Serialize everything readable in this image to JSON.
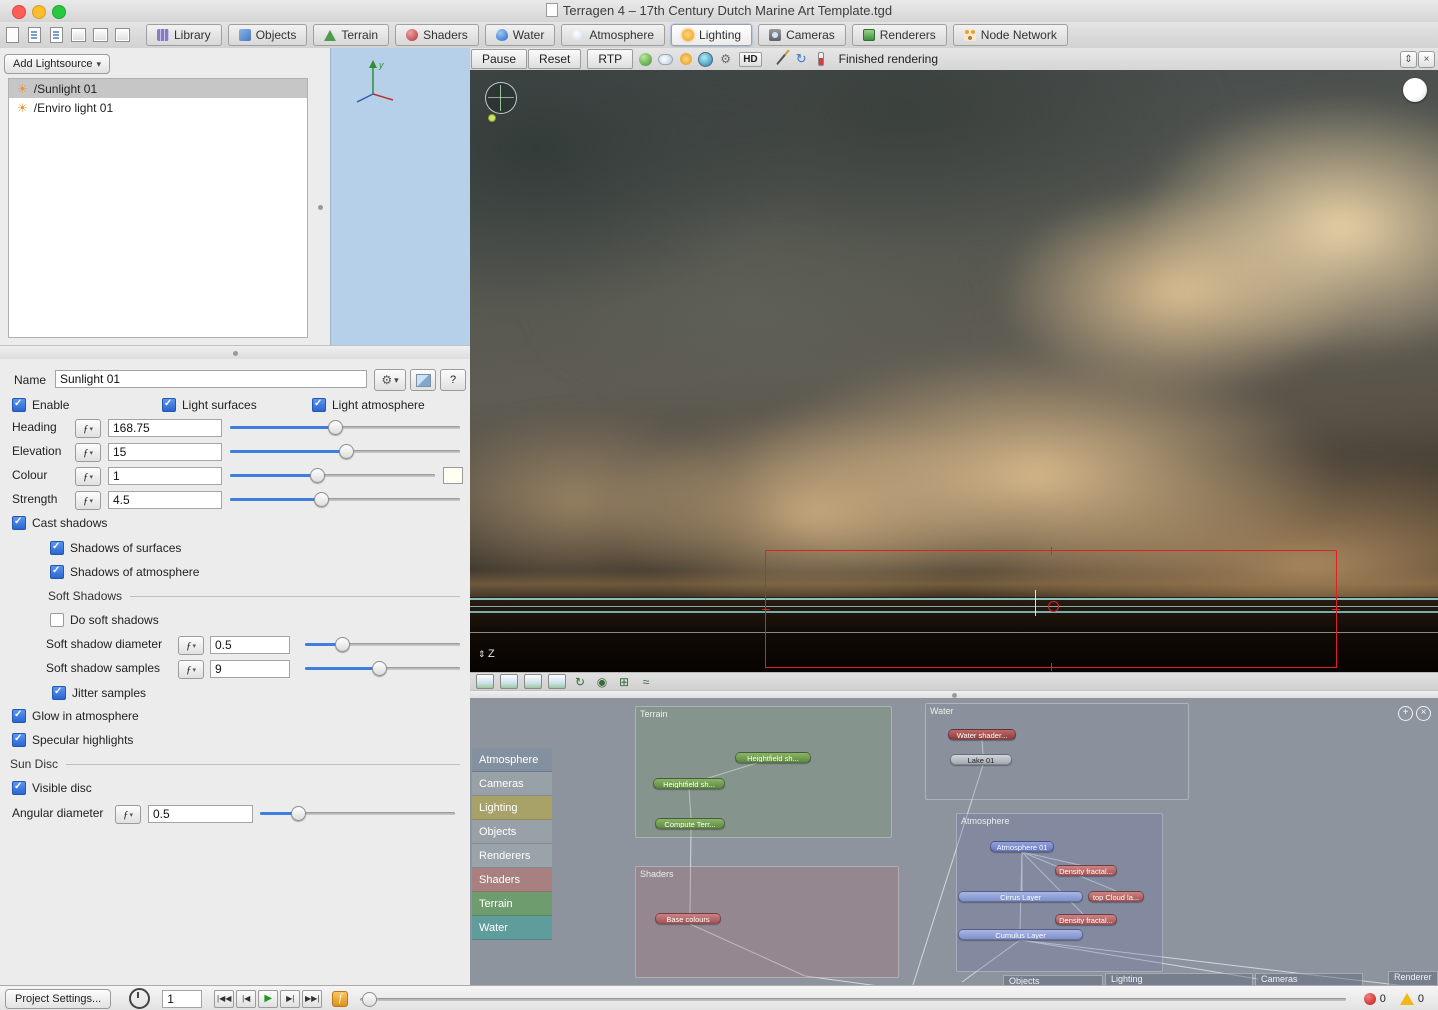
{
  "titlebar": {
    "title": "Terragen 4 – 17th Century Dutch Marine Art Template.tgd"
  },
  "toolbar": {
    "tabs": [
      {
        "label": "Library"
      },
      {
        "label": "Objects"
      },
      {
        "label": "Terrain"
      },
      {
        "label": "Shaders"
      },
      {
        "label": "Water"
      },
      {
        "label": "Atmosphere"
      },
      {
        "label": "Lighting"
      },
      {
        "label": "Cameras"
      },
      {
        "label": "Renderers"
      },
      {
        "label": "Node Network"
      }
    ]
  },
  "lightsources": {
    "add_button": "Add Lightsource",
    "items": [
      {
        "label": "/Sunlight 01"
      },
      {
        "label": "/Enviro light 01"
      }
    ]
  },
  "render_controls": {
    "pause": "Pause",
    "reset": "Reset",
    "rtp": "RTP",
    "hd": "HD",
    "status": "Finished rendering"
  },
  "render_view": {
    "z_label": "Z"
  },
  "settings": {
    "name_label": "Name",
    "name_value": "Sunlight 01",
    "help_label": "?",
    "enable_label": "Enable",
    "light_surfaces_label": "Light surfaces",
    "light_atmosphere_label": "Light atmosphere",
    "heading": {
      "label": "Heading",
      "value": "168.75"
    },
    "elevation": {
      "label": "Elevation",
      "value": "15"
    },
    "colour": {
      "label": "Colour",
      "value": "1"
    },
    "strength": {
      "label": "Strength",
      "value": "4.5"
    },
    "cast_shadows_label": "Cast shadows",
    "shadows_of_surfaces_label": "Shadows of surfaces",
    "shadows_of_atmosphere_label": "Shadows of atmosphere",
    "soft_shadows_header": "Soft Shadows",
    "do_soft_shadows_label": "Do soft shadows",
    "soft_shadow_diameter": {
      "label": "Soft shadow diameter",
      "value": "0.5"
    },
    "soft_shadow_samples": {
      "label": "Soft shadow samples",
      "value": "9"
    },
    "jitter_samples_label": "Jitter samples",
    "glow_in_atmosphere_label": "Glow in atmosphere",
    "specular_highlights_label": "Specular highlights",
    "sun_disc_header": "Sun Disc",
    "visible_disc_label": "Visible disc",
    "angular_diameter": {
      "label": "Angular diameter",
      "value": "0.5"
    }
  },
  "node_network": {
    "categories": [
      {
        "label": "Atmosphere"
      },
      {
        "label": "Cameras"
      },
      {
        "label": "Lighting"
      },
      {
        "label": "Objects"
      },
      {
        "label": "Renderers"
      },
      {
        "label": "Shaders"
      },
      {
        "label": "Terrain"
      },
      {
        "label": "Water"
      }
    ],
    "groups": [
      {
        "label": "Terrain"
      },
      {
        "label": "Water"
      },
      {
        "label": "Shaders"
      },
      {
        "label": "Atmosphere"
      },
      {
        "label": "Objects"
      },
      {
        "label": "Lighting"
      },
      {
        "label": "Cameras"
      },
      {
        "label": "Renderer"
      }
    ],
    "nodes": [
      {
        "label": "Heightfield sh..."
      },
      {
        "label": "Heightfield sh..."
      },
      {
        "label": "Compute Terr..."
      },
      {
        "label": "Water shader..."
      },
      {
        "label": "Lake 01"
      },
      {
        "label": "Base colours"
      },
      {
        "label": "Atmosphere 01"
      },
      {
        "label": "Density fractal..."
      },
      {
        "label": "Cirrus Layer"
      },
      {
        "label": "top Cloud la..."
      },
      {
        "label": "Density fractal..."
      },
      {
        "label": "Cumulus Layer"
      }
    ]
  },
  "bottom_bar": {
    "project_settings": "Project Settings...",
    "frame": "1",
    "errors": "0",
    "warnings": "0"
  },
  "colors": {
    "accent": "#3f7ee0",
    "selection_red": "#dd2222",
    "sea_line_cyan": "#a9dede",
    "node_green": "#6f9a50",
    "node_red": "#b85c5c",
    "node_blue": "#7d8fd0"
  }
}
